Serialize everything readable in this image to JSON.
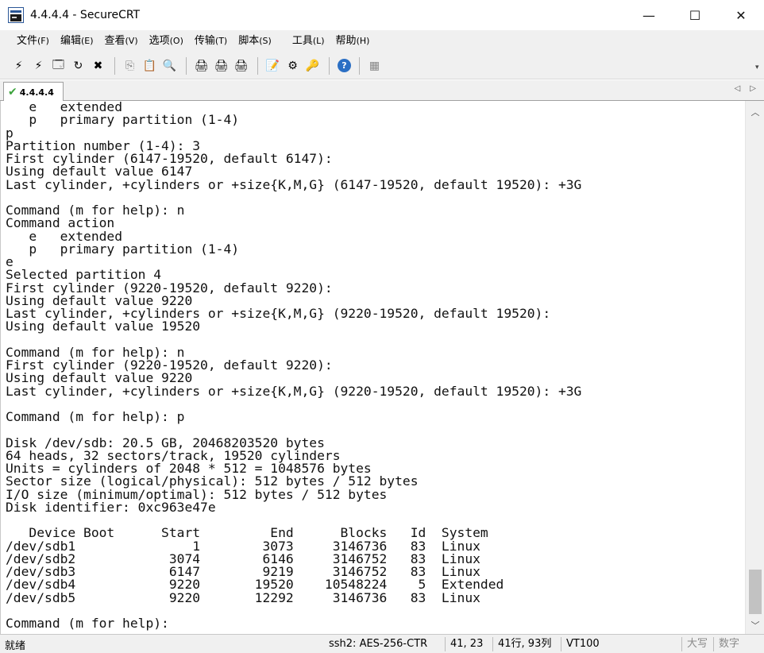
{
  "window": {
    "title": "4.4.4.4 - SecureCRT",
    "minimize": "—",
    "maximize": "☐",
    "close": "✕"
  },
  "menu": [
    {
      "label": "文件",
      "accel": "(F)"
    },
    {
      "label": "编辑",
      "accel": "(E)"
    },
    {
      "label": "查看",
      "accel": "(V)"
    },
    {
      "label": "选项",
      "accel": "(O)"
    },
    {
      "label": "传输",
      "accel": "(T)"
    },
    {
      "label": "脚本",
      "accel": "(S)"
    },
    {
      "label": "工具",
      "accel": "(L)"
    },
    {
      "label": "帮助",
      "accel": "(H)"
    }
  ],
  "toolbar_icons": {
    "connect": "⚡",
    "quick_connect": "⚡",
    "connect_tab": "🗔",
    "reconnect": "↻",
    "disconnect": "✖",
    "copy": "⎘",
    "paste": "📋",
    "find": "🔍",
    "print": "🖨",
    "print_selection": "🖨",
    "print_setup": "🖨",
    "session_options": "📝",
    "global_options": "⚙",
    "keymap": "🔑",
    "help": "?",
    "screen": "▦"
  },
  "tab": {
    "label": "4.4.4.4",
    "check": "✔",
    "prev": "◁",
    "next": "▷"
  },
  "terminal": {
    "content": "   e   extended\n   p   primary partition (1-4)\np\nPartition number (1-4): 3\nFirst cylinder (6147-19520, default 6147):\nUsing default value 6147\nLast cylinder, +cylinders or +size{K,M,G} (6147-19520, default 19520): +3G\n\nCommand (m for help): n\nCommand action\n   e   extended\n   p   primary partition (1-4)\ne\nSelected partition 4\nFirst cylinder (9220-19520, default 9220):\nUsing default value 9220\nLast cylinder, +cylinders or +size{K,M,G} (9220-19520, default 19520):\nUsing default value 19520\n\nCommand (m for help): n\nFirst cylinder (9220-19520, default 9220):\nUsing default value 9220\nLast cylinder, +cylinders or +size{K,M,G} (9220-19520, default 19520): +3G\n\nCommand (m for help): p\n\nDisk /dev/sdb: 20.5 GB, 20468203520 bytes\n64 heads, 32 sectors/track, 19520 cylinders\nUnits = cylinders of 2048 * 512 = 1048576 bytes\nSector size (logical/physical): 512 bytes / 512 bytes\nI/O size (minimum/optimal): 512 bytes / 512 bytes\nDisk identifier: 0xc963e47e\n\n   Device Boot      Start         End      Blocks   Id  System\n/dev/sdb1               1        3073     3146736   83  Linux\n/dev/sdb2            3074        6146     3146752   83  Linux\n/dev/sdb3            6147        9219     3146752   83  Linux\n/dev/sdb4            9220       19520    10548224    5  Extended\n/dev/sdb5            9220       12292     3146736   83  Linux\n\nCommand (m for help): "
  },
  "scrollbar": {
    "up": "︿",
    "down": "﹀"
  },
  "status": {
    "ready": "就绪",
    "protocol": "ssh2: AES-256-CTR",
    "position": "41,  23",
    "size": "41行, 93列",
    "emulation": "VT100",
    "caps": "大写",
    "num": "数字"
  },
  "colors": {
    "chrome": "#f0f0f0",
    "terminal_bg": "#ffffff",
    "terminal_fg": "#111111",
    "tab_check": "#3ca33c",
    "icon_blue": "#2b5797"
  }
}
